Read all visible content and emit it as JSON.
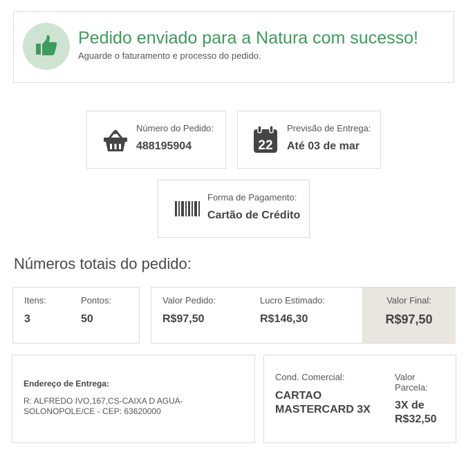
{
  "banner": {
    "title": "Pedido enviado para a Natura com sucesso!",
    "subtitle": "Aguarde o faturamento e processo do pedido.",
    "accent_color": "#3f9b5c",
    "icon": "thumbs-up-icon"
  },
  "order_number": {
    "label": "Número do Pedido:",
    "value": "488195904",
    "icon": "basket-icon"
  },
  "delivery": {
    "label": "Previsão de Entrega:",
    "value": "Até 03 de mar",
    "icon": "calendar-icon",
    "icon_day": "22"
  },
  "payment": {
    "label": "Forma de Pagamento:",
    "value": "Cartão de Crédito",
    "icon": "barcode-icon"
  },
  "totals": {
    "heading": "Números totais do pedido:",
    "items_label": "Itens:",
    "items_value": "3",
    "points_label": "Pontos:",
    "points_value": "50",
    "order_value_label": "Valor Pedido:",
    "order_value": "R$97,50",
    "profit_label": "Lucro Estimado:",
    "profit_value": "R$146,30",
    "final_label": "Valor Final:",
    "final_value": "R$97,50"
  },
  "address": {
    "label": "Endereço de Entrega:",
    "line1": "R: ALFREDO IVO,167,CS-CAIXA D AGUA-",
    "line2": "SOLONOPOLE/CE - CEP: 63620000"
  },
  "commercial": {
    "label": "Cond. Comercial:",
    "value_line1": "CARTAO",
    "value_line2": "MASTERCARD 3X",
    "installment_label_line1": "Valor",
    "installment_label_line2": "Parcela:",
    "installment_value_line1": "3X de",
    "installment_value_line2": "R$32,50"
  }
}
